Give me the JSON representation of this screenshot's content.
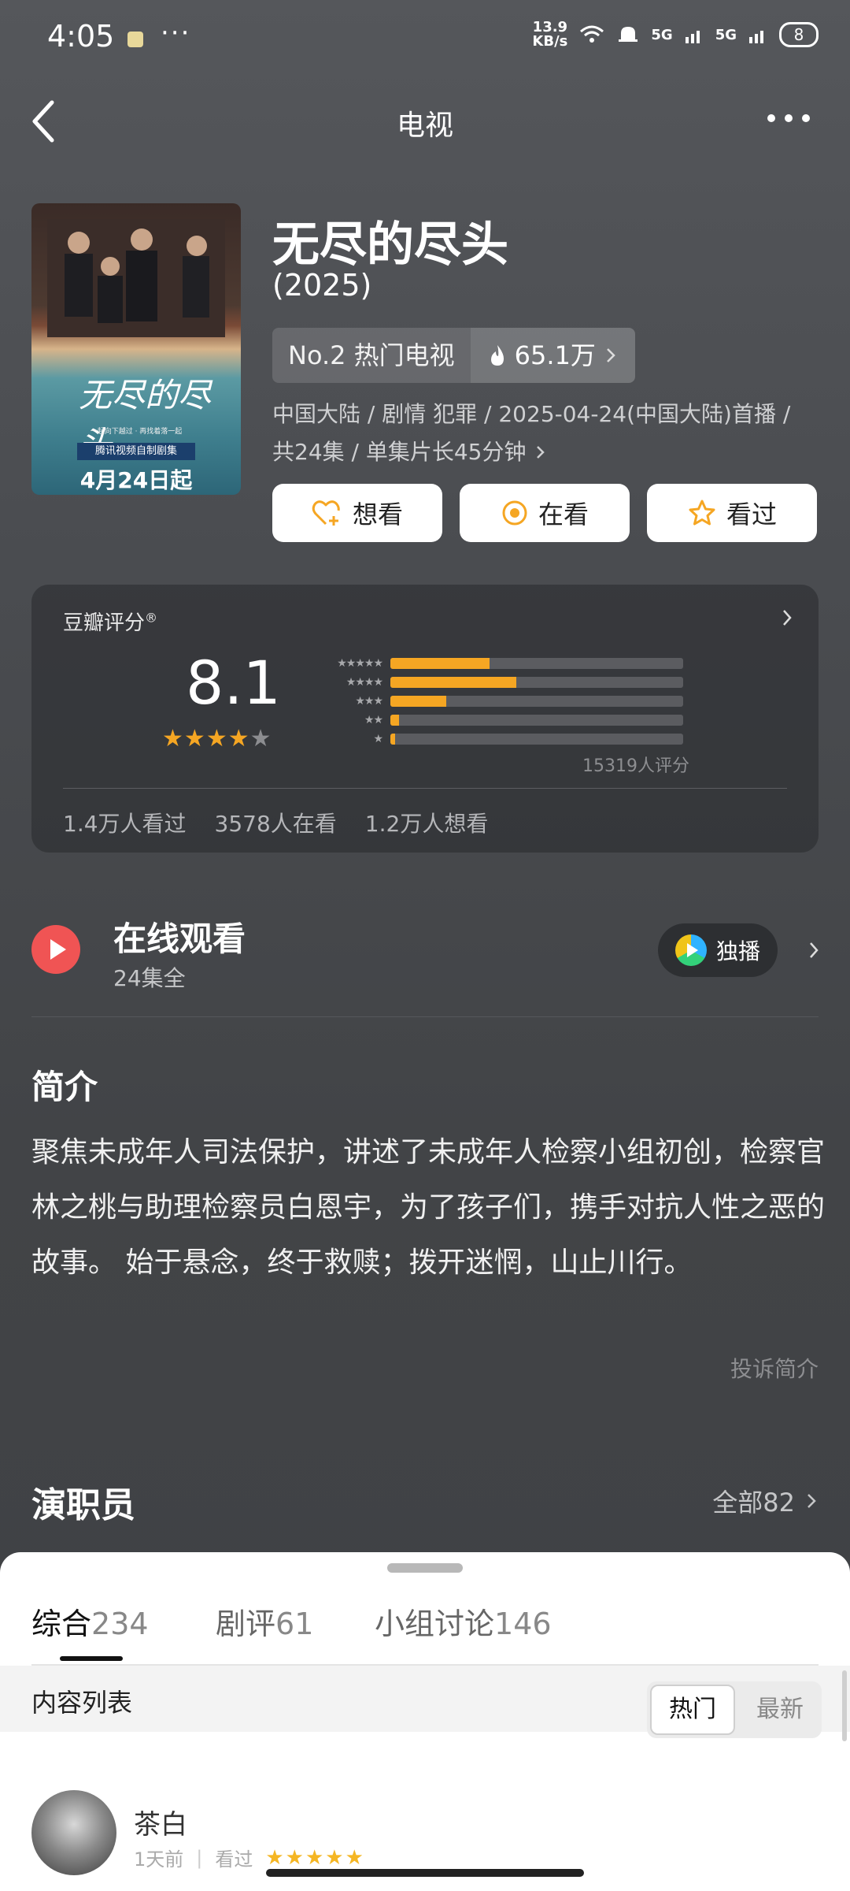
{
  "status_bar": {
    "time": "4:05",
    "dots": "···",
    "net_speed_top": "13.9",
    "net_speed_bottom": "KB/s",
    "sig1": "5G",
    "sig2": "5G",
    "battery": "8"
  },
  "nav": {
    "title": "电视"
  },
  "poster": {
    "title_art": "无尽的尽头",
    "tagline": "一起向下越过 · 再找着落一起",
    "badge": "腾讯视频自制剧集",
    "date": "4月24日起"
  },
  "show": {
    "title": "无尽的尽头",
    "year": "(2025)",
    "rank_label": "No.2 热门电视",
    "heat": "65.1万",
    "meta_line1": "中国大陆 / 剧情 犯罪 / 2025-04-24(中国大陆)首播 /",
    "meta_line2": "共24集 / 单集片长45分钟"
  },
  "actions": {
    "want": "想看",
    "watching": "在看",
    "watched": "看过"
  },
  "rating": {
    "label": "豆瓣评分",
    "mark": "®",
    "score": "8.1",
    "stars_value": 4,
    "stars_max": 5,
    "distribution": [
      {
        "stars": 5,
        "fraction": 0.34
      },
      {
        "stars": 4,
        "fraction": 0.43
      },
      {
        "stars": 3,
        "fraction": 0.19
      },
      {
        "stars": 2,
        "fraction": 0.03
      },
      {
        "stars": 1,
        "fraction": 0.015
      }
    ],
    "count": "15319人评分",
    "stat_watched": "1.4万人看过",
    "stat_watching": "3578人在看",
    "stat_want": "1.2万人想看"
  },
  "online": {
    "title": "在线观看",
    "sub": "24集全",
    "exclusive": "独播"
  },
  "synopsis": {
    "heading": "简介",
    "body": "聚焦未成年人司法保护，讲述了未成年人检察小组初创，检察官林之桃与助理检察员白恩宇，为了孩子们，携手对抗人性之恶的故事。 始于悬念，终于救赎；拨开迷惘，山止川行。",
    "complain": "投诉简介"
  },
  "cast": {
    "heading": "演职员",
    "all": "全部82"
  },
  "sheet": {
    "tabs": [
      {
        "label": "综合",
        "count": "234"
      },
      {
        "label": "剧评",
        "count": "61"
      },
      {
        "label": "小组讨论",
        "count": "146"
      }
    ],
    "list_heading": "内容列表",
    "sort_hot": "热门",
    "sort_new": "最新",
    "user_name": "茶白",
    "user_time": "1天前",
    "user_action": "看过",
    "user_stars": "★★★★★"
  },
  "colors": {
    "accent": "#f5a623",
    "play_red": "#f05454"
  }
}
